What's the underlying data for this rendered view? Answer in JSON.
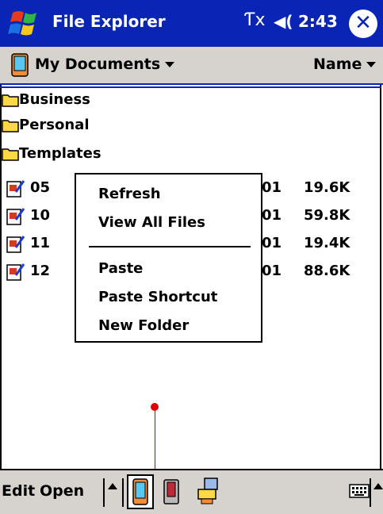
{
  "title_bar": {
    "app_title": "File Explorer",
    "connectivity_glyph": "Ƭx",
    "volume_glyph": "◀(",
    "time": "2:43",
    "close_glyph": "✕"
  },
  "header": {
    "folder": "My Documents",
    "sort_by": "Name"
  },
  "items": [
    {
      "name": "Business",
      "type": "folder"
    },
    {
      "name": "Personal",
      "type": "folder"
    },
    {
      "name": "Templates",
      "type": "folder"
    },
    {
      "name": "05",
      "type": "file",
      "date": "01",
      "size": "19.6K"
    },
    {
      "name": "10",
      "type": "file",
      "date": "01",
      "size": "59.8K"
    },
    {
      "name": "11",
      "type": "file",
      "date": "01",
      "size": "19.4K"
    },
    {
      "name": "12",
      "type": "file",
      "date": "01",
      "size": "88.6K"
    }
  ],
  "context_menu": {
    "items": [
      "Refresh",
      "View All Files",
      "Paste",
      "Paste Shortcut",
      "New Folder"
    ]
  },
  "bottom_bar": {
    "edit": "Edit",
    "open": "Open"
  },
  "colors": {
    "title_bar": "#0a24b6",
    "chrome": "#d6d3ce",
    "folder_yellow": "#ffd84a",
    "tap_indicator": "#e00000"
  }
}
